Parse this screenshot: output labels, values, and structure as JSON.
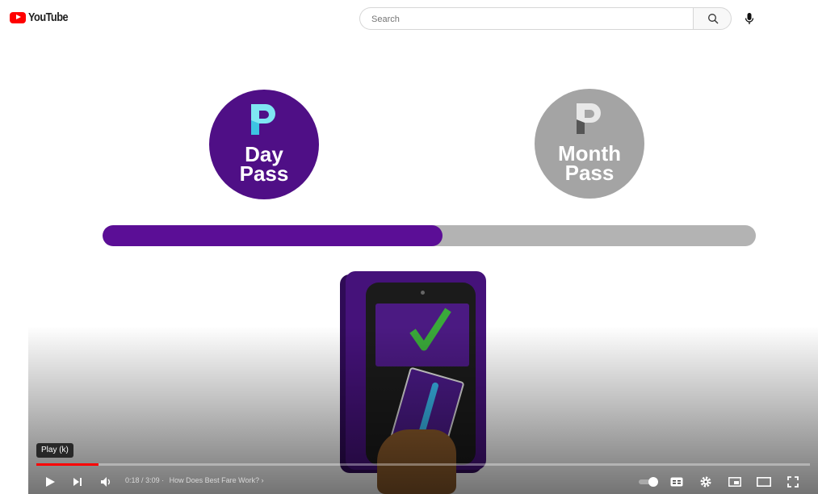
{
  "header": {
    "logo_text": "YouTube",
    "search_placeholder": "Search"
  },
  "video": {
    "passes": [
      {
        "line1": "Day",
        "line2": "Pass",
        "color": "#4f0f86",
        "selected": true
      },
      {
        "line1": "Month",
        "line2": "Pass",
        "color": "#a4a4a4",
        "selected": false
      }
    ],
    "pass_progress_percent": 52,
    "player": {
      "tooltip": "Play (k)",
      "watched_percent": 8,
      "time_current": "0:18",
      "time_total": "3:09",
      "chapter_title": "How Does Best Fare Work?",
      "chapter_arrow": "›"
    }
  },
  "colors": {
    "youtube_red": "#ff0000",
    "pass_purple": "#4f0f86",
    "pass_gray": "#a4a4a4",
    "check_green": "#3aa93a"
  }
}
